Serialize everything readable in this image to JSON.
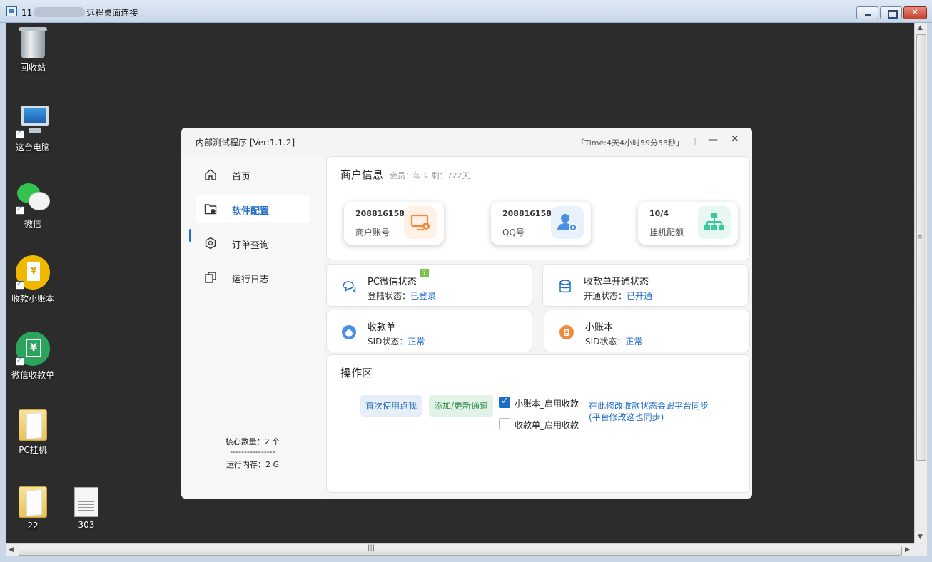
{
  "rdp": {
    "title_prefix": "11",
    "title_suffix": "远程桌面连接"
  },
  "desktop_icons": [
    {
      "label": "回收站"
    },
    {
      "label": "这台电脑"
    },
    {
      "label": "微信"
    },
    {
      "label": "收款小账本"
    },
    {
      "label": "微信收款单"
    },
    {
      "label": "PC挂机"
    },
    {
      "label": "22"
    },
    {
      "label": "303"
    }
  ],
  "app": {
    "title": "内部测试程序  [Ver:1.1.2]",
    "time": "「Time:4天4小时59分53秒」",
    "separator": "|",
    "minimize_glyph": "—",
    "close_glyph": "✕"
  },
  "sidebar": {
    "items": [
      {
        "label": "首页",
        "icon": "home-icon"
      },
      {
        "label": "软件配置",
        "icon": "folder-gear-icon",
        "active": true
      },
      {
        "label": "订单查询",
        "icon": "hexagon-icon"
      },
      {
        "label": "运行日志",
        "icon": "copy-icon"
      }
    ],
    "core_count": "核心数量：2 个",
    "divider": "----------------",
    "memory": "运行内存：2 G"
  },
  "merchant": {
    "title": "商户信息",
    "membership": "会员：年卡  剩：722天",
    "cards": [
      {
        "value": "208816158",
        "caption": "商户账号",
        "icon": "monitor-gear-icon",
        "color": "#f08a3c"
      },
      {
        "value": "208816158",
        "caption": "QQ号",
        "icon": "user-gear-icon",
        "color": "#4a90e2"
      },
      {
        "value": "10/4",
        "caption": "挂机配额",
        "icon": "network-icon",
        "color": "#3cc7a0"
      }
    ]
  },
  "status_cards": [
    {
      "name": "PC微信状态",
      "key": "登陆状态：",
      "value": "已登录",
      "icon": "chat-icon",
      "badge": "?"
    },
    {
      "name": "收款单开通状态",
      "key": "开通状态：",
      "value": "已开通",
      "icon": "database-icon"
    },
    {
      "name": "收款单",
      "key": " SID状态：",
      "value": "正常",
      "icon": "money-bag-icon"
    },
    {
      "name": "小账本",
      "key": " SID状态：",
      "value": "正常",
      "icon": "ledger-icon"
    }
  ],
  "ops": {
    "title": "操作区",
    "btn_first_use": "首次使用点我",
    "btn_add_channel": "添加/更新通道",
    "cb_ledger": {
      "label": "小账本_启用收款",
      "checked": true
    },
    "cb_receipt": {
      "label": "收款单_启用收款",
      "checked": false
    },
    "note": "在此修改收款状态会跟平台同步(平台修改这也同步)"
  },
  "colors": {
    "accent": "#1f6bc9",
    "desktop_bg": "#2c2c2c"
  }
}
